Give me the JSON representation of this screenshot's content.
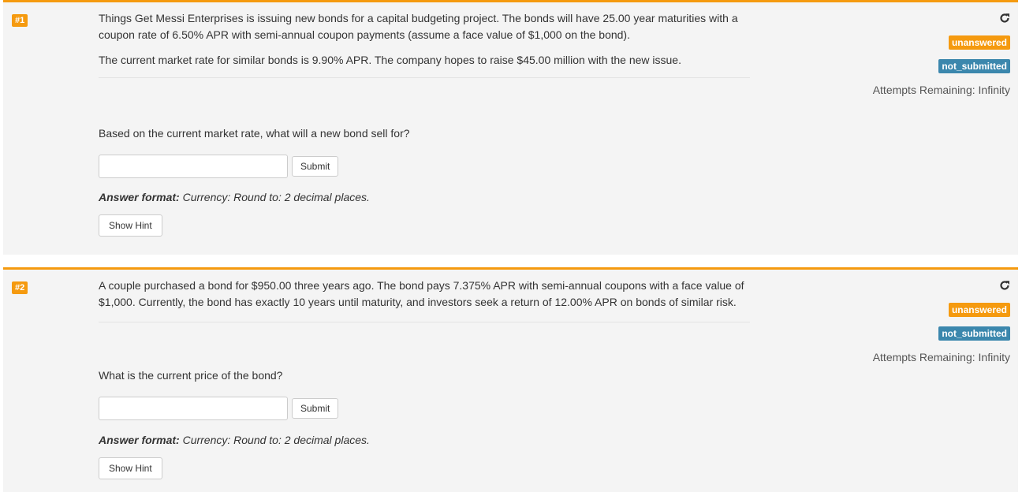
{
  "questions": [
    {
      "number": "#1",
      "text_paragraphs": [
        "Things Get Messi Enterprises is issuing new bonds for a capital budgeting project. The bonds will have 25.00 year maturities with a coupon rate of 6.50% APR with semi-annual coupon payments (assume a face value of $1,000 on the bond).",
        "The current market rate for similar bonds is 9.90% APR. The company hopes to raise $45.00 million with the new issue."
      ],
      "prompt": "Based on the current market rate, what will a new bond sell for?",
      "answer_value": "",
      "submit_label": "Submit",
      "format_label": "Answer format:",
      "format_value": "Currency: Round to: 2 decimal places.",
      "hint_label": "Show Hint",
      "status_badge": "unanswered",
      "submission_badge": "not_submitted",
      "attempts": "Attempts Remaining: Infinity"
    },
    {
      "number": "#2",
      "text_paragraphs": [
        "A couple purchased a bond for $950.00 three years ago. The bond pays 7.375% APR with semi-annual coupons with a face value of $1,000. Currently, the bond has exactly 10 years until maturity, and investors seek a return of 12.00% APR on bonds of similar risk."
      ],
      "prompt": "What is the current price of the bond?",
      "answer_value": "",
      "submit_label": "Submit",
      "format_label": "Answer format:",
      "format_value": "Currency: Round to: 2 decimal places.",
      "hint_label": "Show Hint",
      "status_badge": "unanswered",
      "submission_badge": "not_submitted",
      "attempts": "Attempts Remaining: Infinity"
    }
  ],
  "icons": {
    "reload": "reload-icon"
  },
  "colors": {
    "accent_orange": "#f59a0f",
    "badge_blue": "#3b87ad",
    "card_background": "#f4f4f4"
  }
}
